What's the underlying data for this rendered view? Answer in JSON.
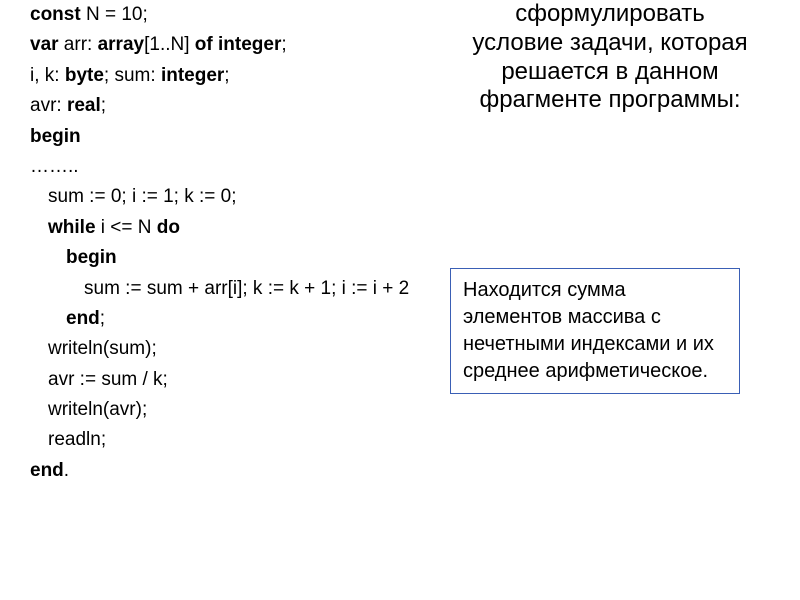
{
  "title": "сформулировать условие задачи, которая решается в данном фрагменте программы:",
  "code": {
    "l1a": "const",
    "l1b": " N = 10;",
    "l2a": "var",
    "l2b": " arr: ",
    "l2c": "array",
    "l2d": "[1..N] ",
    "l2e": "of integer",
    "l2f": ";",
    "l3a": "i, k: ",
    "l3b": "byte",
    "l3c": "; sum: ",
    "l3d": "integer",
    "l3e": ";",
    "l4a": "avr: ",
    "l4b": "real",
    "l4c": ";",
    "l5": "begin",
    "l6": "……..",
    "l7": "sum := 0; i := 1; k := 0;",
    "l8a": "while",
    "l8b": " i <= N ",
    "l8c": "do",
    "l9": "begin",
    "l10": "sum := sum + arr[i]; k := k + 1; i := i + 2",
    "l11a": "end",
    "l11b": ";",
    "l12": "writeln(sum);",
    "l13": "avr := sum / k;",
    "l14": "writeln(avr);",
    "l15": "readln;",
    "l16a": "end",
    "l16b": "."
  },
  "answer": "Находится сумма элементов массива с нечетными индексами и их среднее арифметическое."
}
